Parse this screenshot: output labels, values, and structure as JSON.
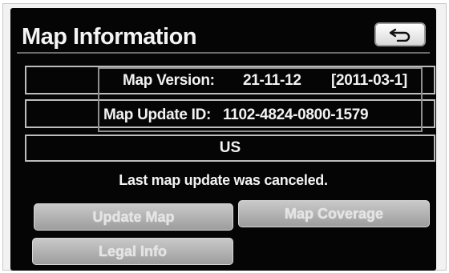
{
  "header": {
    "title": "Map Information",
    "back_icon": "back-arrow-icon"
  },
  "info": {
    "version_label": "Map Version:",
    "version_value": "21-11-12",
    "version_date": "[2011-03-1]",
    "update_id_label": "Map Update ID:",
    "update_id_value": "1102-4824-0800-1579",
    "region": "US"
  },
  "status": {
    "message": "Last map update was canceled."
  },
  "buttons": {
    "update_map": "Update Map",
    "map_coverage": "Map Coverage",
    "legal_info": "Legal Info"
  },
  "colors": {
    "screen_background": "#050505",
    "text": "#f2f2f2",
    "button": "#b3b3b3"
  }
}
